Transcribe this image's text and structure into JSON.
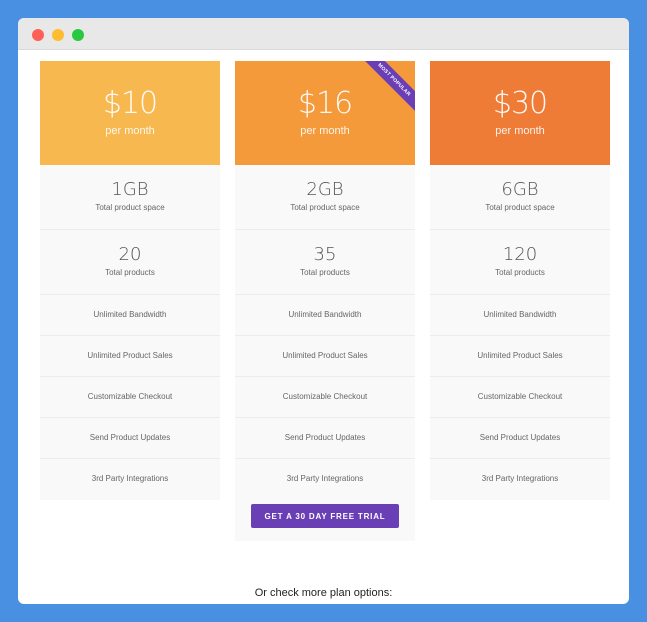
{
  "colors": {
    "background": "#4a90e2",
    "plan1_header": "#f7b84f",
    "plan2_header": "#f49a3a",
    "plan3_header": "#ee7c36",
    "cta": "#6a3fb5",
    "ribbon": "#6a3fb5"
  },
  "plans": [
    {
      "price": "$10",
      "period": "per month",
      "storage": "1GB",
      "storage_label": "Total product space",
      "products": "20",
      "products_label": "Total products",
      "features": [
        "Unlimited Bandwidth",
        "Unlimited Product Sales",
        "Customizable Checkout",
        "Send Product Updates",
        "3rd Party Integrations"
      ]
    },
    {
      "price": "$16",
      "period": "per month",
      "ribbon": "MOST POPULAR",
      "storage": "2GB",
      "storage_label": "Total product space",
      "products": "35",
      "products_label": "Total products",
      "features": [
        "Unlimited Bandwidth",
        "Unlimited Product Sales",
        "Customizable Checkout",
        "Send Product Updates",
        "3rd Party Integrations"
      ],
      "cta_label": "GET A 30 DAY FREE TRIAL"
    },
    {
      "price": "$30",
      "period": "per month",
      "storage": "6GB",
      "storage_label": "Total product space",
      "products": "120",
      "products_label": "Total products",
      "features": [
        "Unlimited Bandwidth",
        "Unlimited Product Sales",
        "Customizable Checkout",
        "Send Product Updates",
        "3rd Party Integrations"
      ]
    }
  ],
  "footer": {
    "more_options": "Or check more plan options:"
  }
}
